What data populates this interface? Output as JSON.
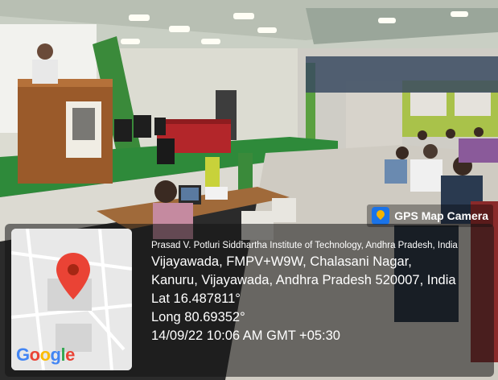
{
  "badge": {
    "label": "GPS Map Camera",
    "icon": "gps-camera-app-icon"
  },
  "map": {
    "brand": [
      "G",
      "o",
      "o",
      "g",
      "l",
      "e"
    ],
    "brand_colors": [
      "#4285F4",
      "#EA4335",
      "#FBBC05",
      "#4285F4",
      "#34A853",
      "#EA4335"
    ],
    "pin_color": "#EA4335"
  },
  "info": {
    "institute": "Prasad V. Potluri Siddhartha Institute of Technology, Andhra Pradesh, India",
    "address_line1": "Vijayawada, FMPV+W9W, Chalasani Nagar,",
    "address_line2": "Kanuru, Vijayawada, Andhra Pradesh 520007, India",
    "lat": "Lat 16.487811°",
    "long": "Long 80.69352°",
    "datetime": "14/09/22 10:06 AM GMT +05:30"
  }
}
